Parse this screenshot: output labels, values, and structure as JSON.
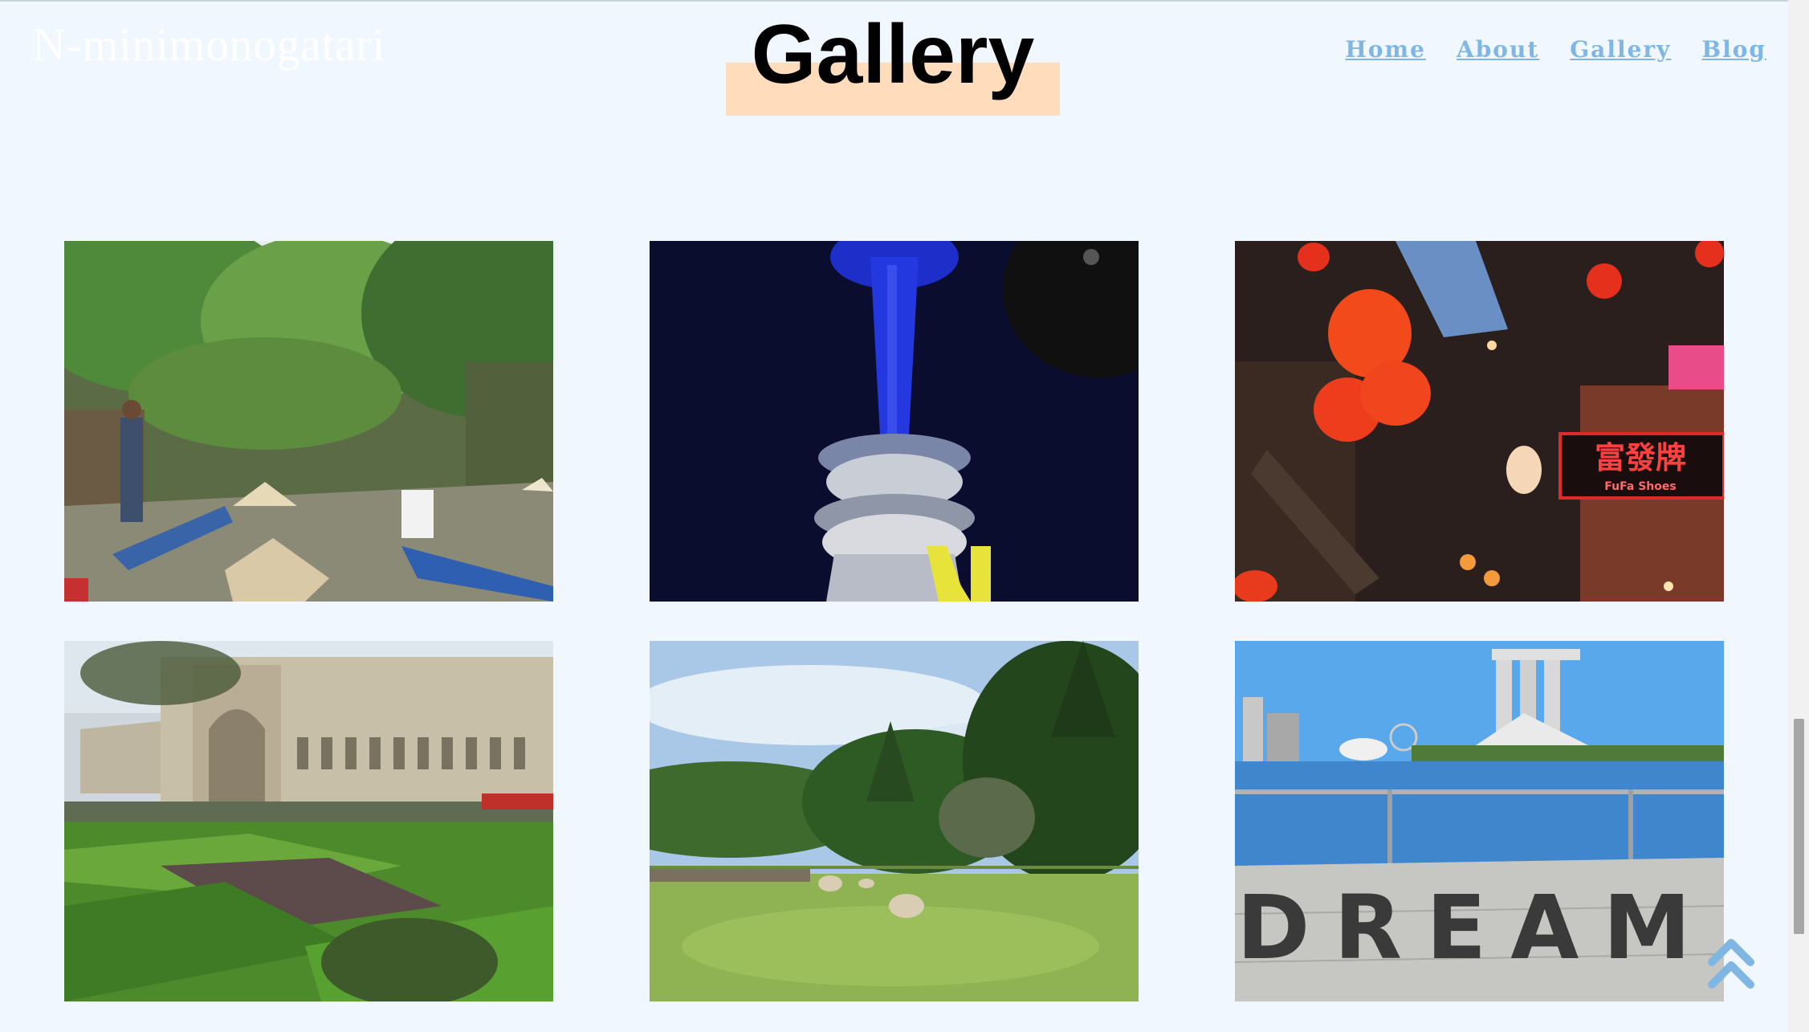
{
  "header": {
    "site_title": "N-minimonogatari",
    "page_title": "Gallery"
  },
  "nav": {
    "items": [
      {
        "label": "Home"
      },
      {
        "label": "About"
      },
      {
        "label": "Gallery"
      },
      {
        "label": "Blog"
      }
    ]
  },
  "gallery": {
    "photos": [
      {
        "subject": "river boats in mangrove forest"
      },
      {
        "subject": "illuminated tower at night"
      },
      {
        "subject": "red lanterns street at night",
        "sign_text": "富發牌",
        "sign_subtext": "FuFa Shoes"
      },
      {
        "subject": "historic building with formal garden"
      },
      {
        "subject": "sheep grazing in green pasture"
      },
      {
        "subject": "waterfront skyline with letters",
        "sign_text": "DREAM"
      }
    ]
  },
  "colors": {
    "background": "#f0f7fe",
    "nav_link": "#7fb6e4",
    "title_highlight": "#ffdcbc",
    "scroll_top_icon": "#7fb6e4"
  },
  "icons": {
    "scroll_to_top": "double-chevron-up-icon"
  }
}
